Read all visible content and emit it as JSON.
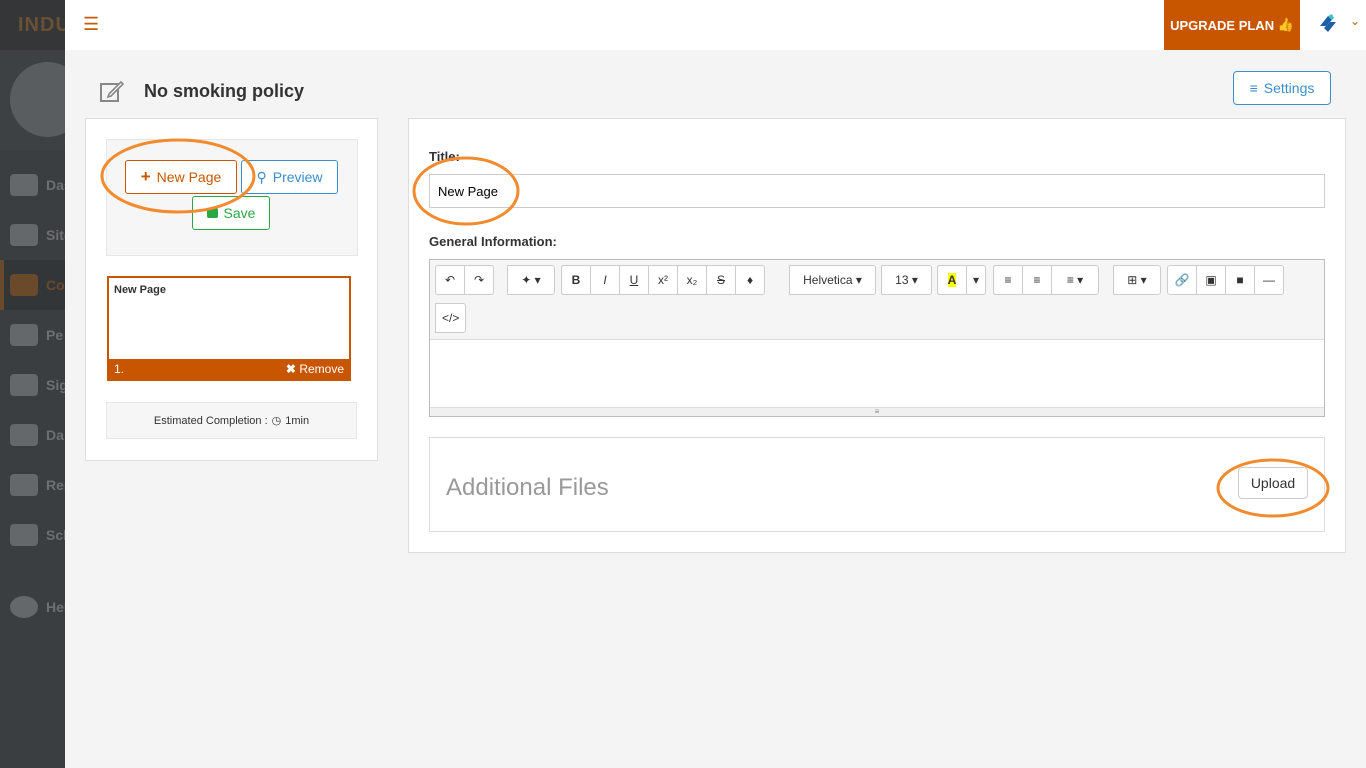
{
  "sidebar": {
    "brand": "INDUC",
    "items": [
      {
        "label": "Das",
        "icon": "dashboard-icon"
      },
      {
        "label": "Site",
        "icon": "globe-icon"
      },
      {
        "label": "Con",
        "icon": "book-icon",
        "active": true
      },
      {
        "label": "Pe",
        "icon": "people-icon"
      },
      {
        "label": "Sign",
        "icon": "walking-icon"
      },
      {
        "label": "Da",
        "icon": "hand-icon"
      },
      {
        "label": "Rep",
        "icon": "bar-chart-icon"
      },
      {
        "label": "Sche",
        "icon": "calendar-icon"
      },
      {
        "label": "Help",
        "icon": "help-icon"
      }
    ]
  },
  "topbar": {
    "upgrade": "UPGRADE PLAN"
  },
  "page": {
    "title": "No smoking policy",
    "settings": "Settings"
  },
  "left": {
    "new_page": "New Page",
    "preview": "Preview",
    "save": "Save",
    "page_card": {
      "name": "New Page",
      "number": "1.",
      "remove": "Remove"
    },
    "estimated_label": "Estimated Completion :",
    "estimated_value": "1min"
  },
  "form": {
    "title_label": "Title:",
    "title_value": "New Page",
    "general_label": "General Information:",
    "font": "Helvetica",
    "font_size": "13",
    "additional_files": "Additional Files",
    "upload": "Upload"
  },
  "colors": {
    "accent": "#c85600",
    "blue": "#3b8ecb",
    "green": "#28a745",
    "annotation": "#f28a2e"
  }
}
